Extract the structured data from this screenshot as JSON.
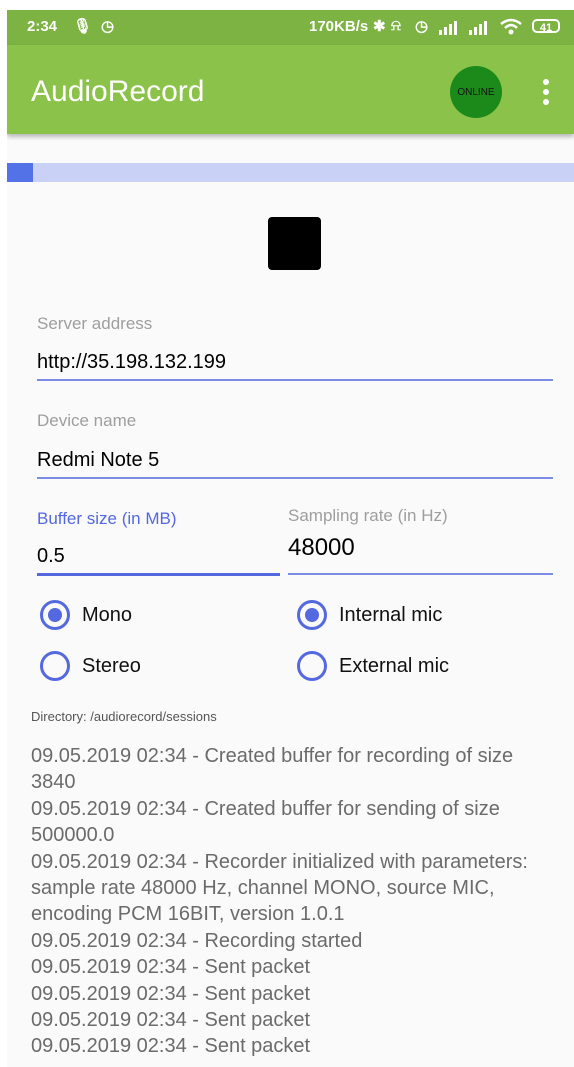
{
  "status_bar": {
    "time": "2:34",
    "net_speed": "170KB/s",
    "battery": "41"
  },
  "app_bar": {
    "title": "AudioRecord",
    "status_badge": "ONLINE",
    "badge_color": "#1b8a1b"
  },
  "colors": {
    "primary": "#8bc34a",
    "status_bar": "#7cb342",
    "accent": "#5468e0"
  },
  "progress": {
    "value": 0.045
  },
  "form": {
    "server_address": {
      "label": "Server address",
      "value": "http://35.198.132.199"
    },
    "device_name": {
      "label": "Device name",
      "value": "Redmi Note 5"
    },
    "buffer_size": {
      "label": "Buffer size (in MB)",
      "value": "0.5"
    },
    "sampling_rate": {
      "label": "Sampling rate (in Hz)",
      "value": "48000"
    }
  },
  "channel": {
    "options": [
      "Mono",
      "Stereo"
    ],
    "selected": "Mono"
  },
  "mic": {
    "options": [
      "Internal mic",
      "External mic"
    ],
    "selected": "Internal mic"
  },
  "directory": "Directory: /audiorecord/sessions",
  "log": [
    "09.05.2019 02:34 - Created buffer for recording of size 3840",
    "09.05.2019 02:34 - Created buffer for sending of size 500000.0",
    "09.05.2019 02:34 - Recorder initialized with parameters: sample rate 48000 Hz, channel MONO, source MIC, encoding PCM 16BIT, version 1.0.1",
    "09.05.2019 02:34 - Recording started",
    "09.05.2019 02:34 - Sent packet",
    "09.05.2019 02:34 - Sent packet",
    "09.05.2019 02:34 - Sent packet",
    "09.05.2019 02:34 - Sent packet"
  ]
}
